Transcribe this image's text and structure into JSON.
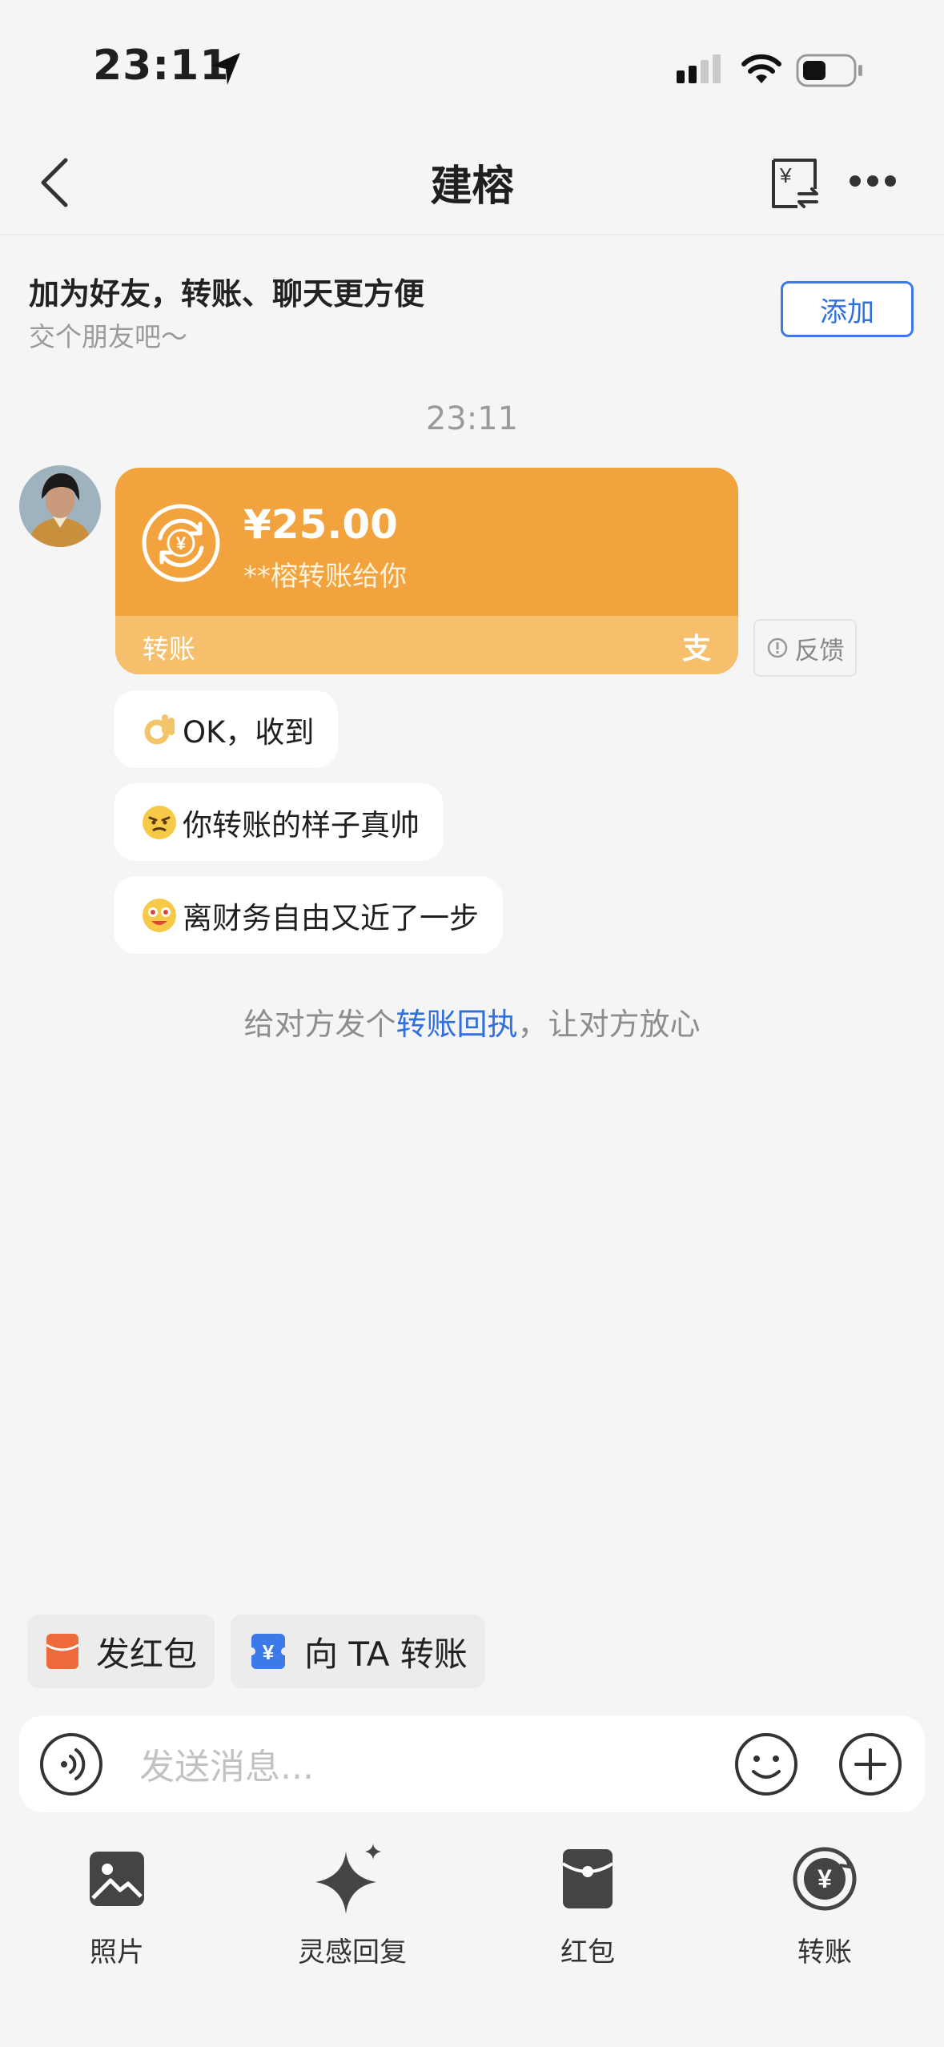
{
  "status_bar": {
    "time": "23:11"
  },
  "nav": {
    "title": "建榕"
  },
  "banner": {
    "title": "加为好友，转账、聊天更方便",
    "subtitle": "交个朋友吧～",
    "add_label": "添加"
  },
  "chat": {
    "timestamp": "23:11",
    "transfer_card": {
      "amount": "¥25.00",
      "description": "**榕转账给你",
      "type_label": "转账"
    },
    "feedback_label": "反馈",
    "messages": [
      {
        "text": "OK，收到"
      },
      {
        "text": "你转账的样子真帅"
      },
      {
        "text": "离财务自由又近了一步"
      }
    ],
    "hint": {
      "prefix": "给对方发个",
      "link": "转账回执",
      "suffix": "，让对方放心"
    }
  },
  "quick_actions": [
    {
      "label": "发红包"
    },
    {
      "label": "向 TA 转账"
    }
  ],
  "input": {
    "placeholder": "发送消息..."
  },
  "toolbar": [
    {
      "label": "照片",
      "icon": "photo-icon"
    },
    {
      "label": "灵感回复",
      "icon": "sparkle-icon"
    },
    {
      "label": "红包",
      "icon": "red-packet-icon"
    },
    {
      "label": "转账",
      "icon": "transfer-icon"
    }
  ],
  "colors": {
    "accent_blue": "#2f6fe0",
    "transfer_orange": "#f2a33d",
    "red_packet": "#ee6a3a"
  }
}
